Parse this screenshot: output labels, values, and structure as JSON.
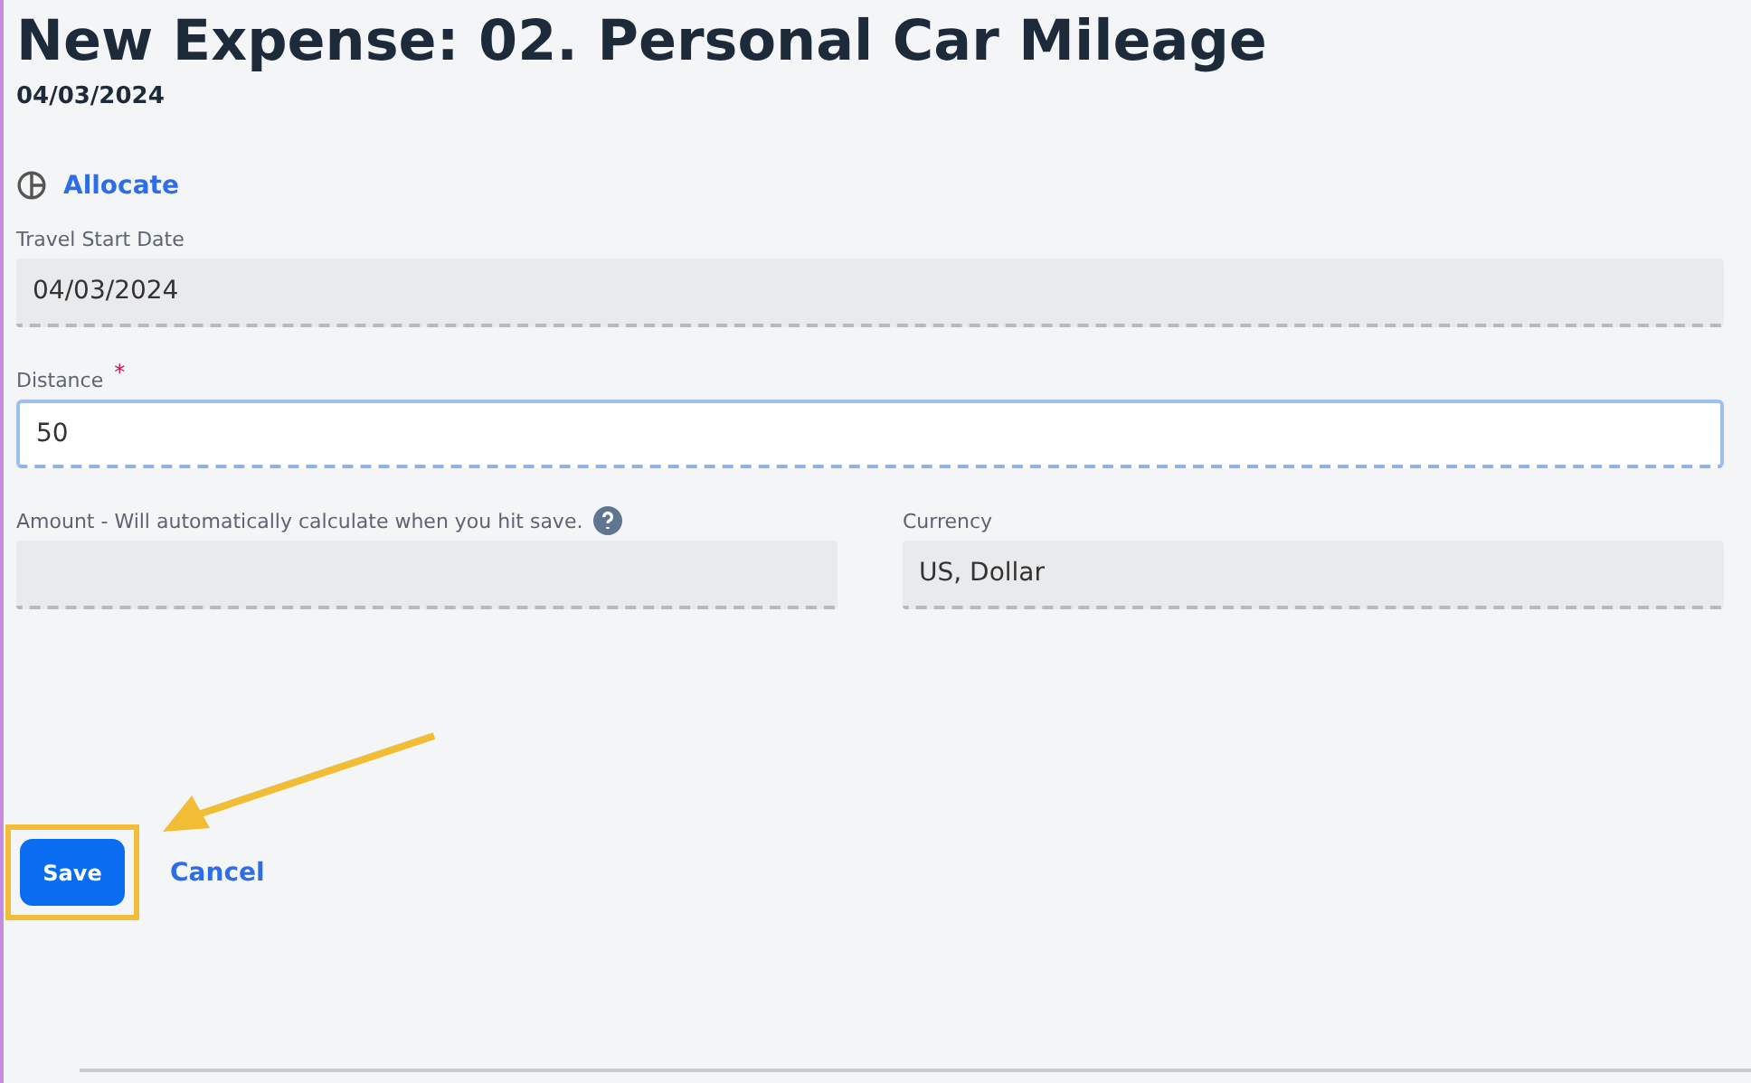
{
  "title": "New Expense: 02. Personal Car Mileage",
  "date": "04/03/2024",
  "allocate_link": "Allocate",
  "rows": [
    [
      {
        "label": "Travel Start Date",
        "value": "04/03/2024",
        "disabled": true,
        "focused": false
      }
    ],
    [
      {
        "label": "Distance",
        "required_mark": "*",
        "value": "50",
        "disabled": false,
        "focused": true
      }
    ],
    [
      {
        "label": "Amount - Will automatically calculate when you hit save.",
        "help": true,
        "disabled": true,
        "focused": false
      },
      {
        "label": "Currency",
        "value": "US, Dollar",
        "disabled": true,
        "focused": false
      }
    ]
  ],
  "buttons": [
    {
      "label": "Save",
      "kind": "primary",
      "highlighted": true
    },
    {
      "label": "Cancel",
      "kind": "link",
      "highlighted": false
    }
  ]
}
